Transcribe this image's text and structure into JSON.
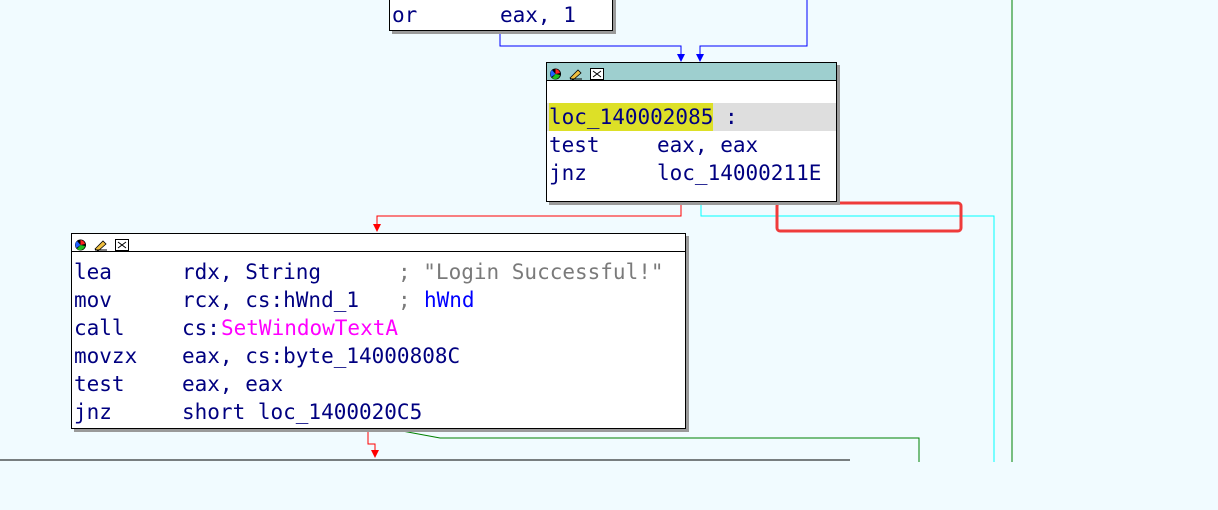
{
  "colors": {
    "background": "#f1fbff",
    "node_header_selected": "#9ecfcf",
    "node_header": "#ffffff",
    "text": "#000080",
    "comment": "#7a7a7a",
    "api_name": "#ff00ff",
    "label_highlight": "#dde027",
    "edge_true": "#008000",
    "edge_false": "#ff0000",
    "edge_normal": "#0000ff",
    "edge_cyan": "#00ffff",
    "annotation_box": "#ef3b3b"
  },
  "top_block": {
    "mnemonic": "or",
    "operands": "eax, 1"
  },
  "block_2085": {
    "header_icons": [
      "color-icon",
      "rename-icon",
      "graph-icon"
    ],
    "label": "loc_140002085",
    "label_suffix": ":",
    "lines": [
      {
        "mnemonic": "test",
        "operands": "eax, eax"
      },
      {
        "mnemonic": "jnz",
        "operands": "loc_14000211E"
      }
    ]
  },
  "block_login": {
    "header_icons": [
      "color-icon",
      "rename-icon",
      "graph-icon"
    ],
    "lines": [
      {
        "mnemonic": "lea",
        "operands": "rdx, String",
        "comment": "; \"Login Successful!\""
      },
      {
        "mnemonic": "mov",
        "operands": "rcx, cs:hWnd_1",
        "comment_prefix": "; ",
        "comment_name": "hWnd"
      },
      {
        "mnemonic": "call",
        "operands_prefix": "cs:",
        "operands_name": "SetWindowTextA"
      },
      {
        "mnemonic": "movzx",
        "operands": "eax, cs:byte_14000808C"
      },
      {
        "mnemonic": "test",
        "operands": "eax, eax"
      },
      {
        "mnemonic": "jnz",
        "operands": "short loc_1400020C5"
      }
    ]
  }
}
